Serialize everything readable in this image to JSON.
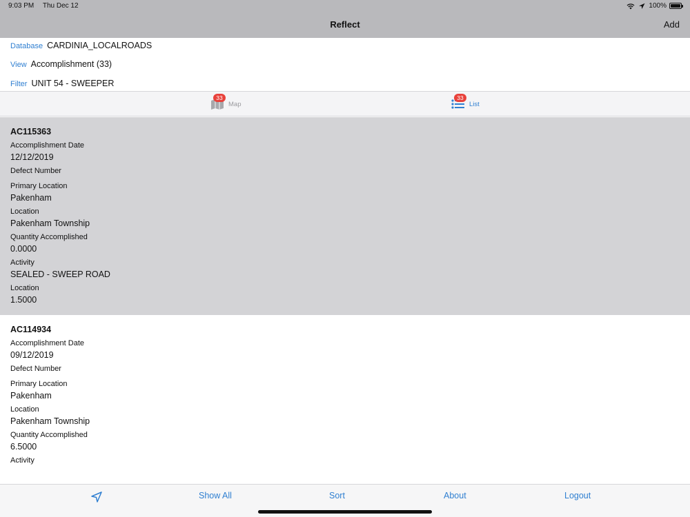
{
  "status_bar": {
    "time": "9:03 PM",
    "date": "Thu Dec 12",
    "battery": "100%"
  },
  "nav": {
    "title": "Reflect",
    "add_label": "Add"
  },
  "info": {
    "database_label": "Database",
    "database_value": "CARDINIA_LOCALROADS",
    "view_label": "View",
    "view_value": "Accomplishment (33)",
    "filter_label": "Filter",
    "filter_value": "UNIT 54 - SWEEPER"
  },
  "tabs": [
    {
      "label": "Map",
      "badge": "33",
      "icon": "map-icon"
    },
    {
      "label": "List",
      "badge": "33",
      "icon": "list-icon",
      "active": true
    }
  ],
  "records": [
    {
      "id": "AC115363",
      "fields": [
        {
          "label": "Accomplishment Date",
          "value": "12/12/2019"
        },
        {
          "label": "Defect Number",
          "value": ""
        },
        {
          "label": "Primary Location",
          "value": "Pakenham"
        },
        {
          "label": "Location",
          "value": "Pakenham Township"
        },
        {
          "label": "Quantity Accomplished",
          "value": "0.0000"
        },
        {
          "label": "Activity",
          "value": "SEALED - SWEEP ROAD"
        },
        {
          "label": "Location",
          "value": "1.5000"
        }
      ]
    },
    {
      "id": "AC114934",
      "fields": [
        {
          "label": "Accomplishment Date",
          "value": "09/12/2019"
        },
        {
          "label": "Defect Number",
          "value": ""
        },
        {
          "label": "Primary Location",
          "value": "Pakenham"
        },
        {
          "label": "Location",
          "value": "Pakenham Township"
        },
        {
          "label": "Quantity Accomplished",
          "value": "6.5000"
        },
        {
          "label": "Activity",
          "value": ""
        }
      ]
    }
  ],
  "toolbar": {
    "locate_icon": "location-arrow-icon",
    "show_all": "Show All",
    "sort": "Sort",
    "about": "About",
    "logout": "Logout"
  },
  "colors": {
    "accent": "#2f7fd1",
    "badge": "#e8413b",
    "selected_row": "#d3d3d6",
    "nav_bar": "#b9b9bc"
  }
}
